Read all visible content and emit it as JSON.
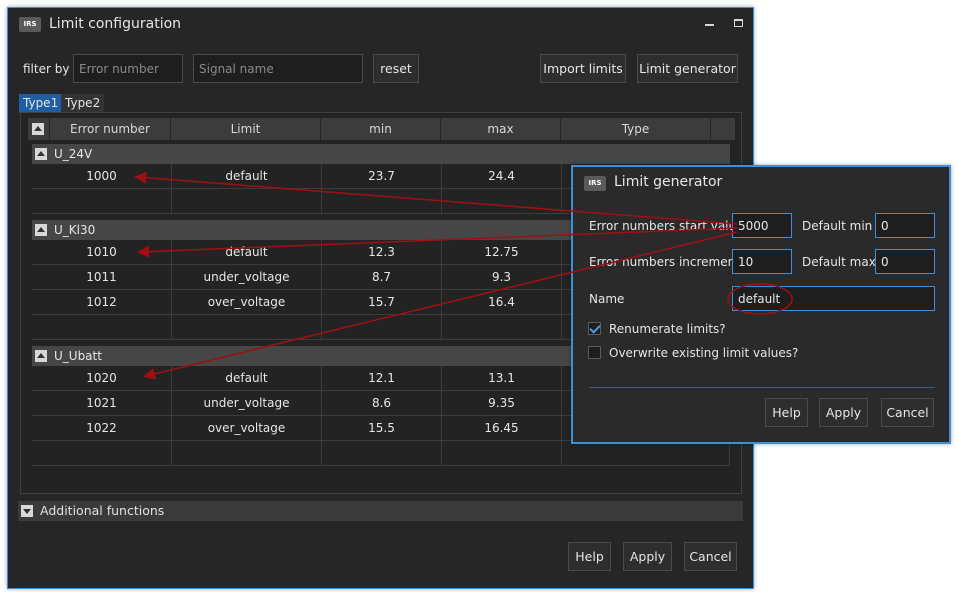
{
  "main_window": {
    "title": "Limit configuration",
    "logo_text": "IRS",
    "filter_label": "filter by",
    "error_number_placeholder": "Error number",
    "signal_name_placeholder": "Signal name",
    "reset_label": "reset",
    "import_limits_label": "Import limits",
    "limit_generator_label": "Limit generator",
    "tabs": [
      "Type1",
      "Type2"
    ],
    "columns": [
      "Error number",
      "Limit",
      "min",
      "max",
      "Type"
    ],
    "groups": [
      {
        "name": "U_24V",
        "rows": [
          {
            "error": "1000",
            "limit": "default",
            "min": "23.7",
            "max": "24.4"
          }
        ]
      },
      {
        "name": "U_Kl30",
        "rows": [
          {
            "error": "1010",
            "limit": "default",
            "min": "12.3",
            "max": "12.75"
          },
          {
            "error": "1011",
            "limit": "under_voltage",
            "min": "8.7",
            "max": "9.3"
          },
          {
            "error": "1012",
            "limit": "over_voltage",
            "min": "15.7",
            "max": "16.4"
          }
        ]
      },
      {
        "name": "U_Ubatt",
        "rows": [
          {
            "error": "1020",
            "limit": "default",
            "min": "12.1",
            "max": "13.1"
          },
          {
            "error": "1021",
            "limit": "under_voltage",
            "min": "8.6",
            "max": "9.35"
          },
          {
            "error": "1022",
            "limit": "over_voltage",
            "min": "15.5",
            "max": "16.45"
          }
        ]
      }
    ],
    "additional_functions_label": "Additional functions",
    "help_label": "Help",
    "apply_label": "Apply",
    "cancel_label": "Cancel"
  },
  "generator_dialog": {
    "title": "Limit generator",
    "logo_text": "IRS",
    "start_value_label": "Error numbers start value",
    "start_value": "5000",
    "default_min_label": "Default min",
    "default_min": "0",
    "increment_label": "Error numbers increment",
    "increment": "10",
    "default_max_label": "Default max",
    "default_max": "0",
    "name_label": "Name",
    "name_value": "default",
    "renumerate_label": "Renumerate limits?",
    "renumerate_checked": true,
    "overwrite_label": "Overwrite existing limit values?",
    "overwrite_checked": false,
    "help_label": "Help",
    "apply_label": "Apply",
    "cancel_label": "Cancel"
  },
  "colors": {
    "accent": "#3c8fd8",
    "annotation": "#a01010"
  }
}
